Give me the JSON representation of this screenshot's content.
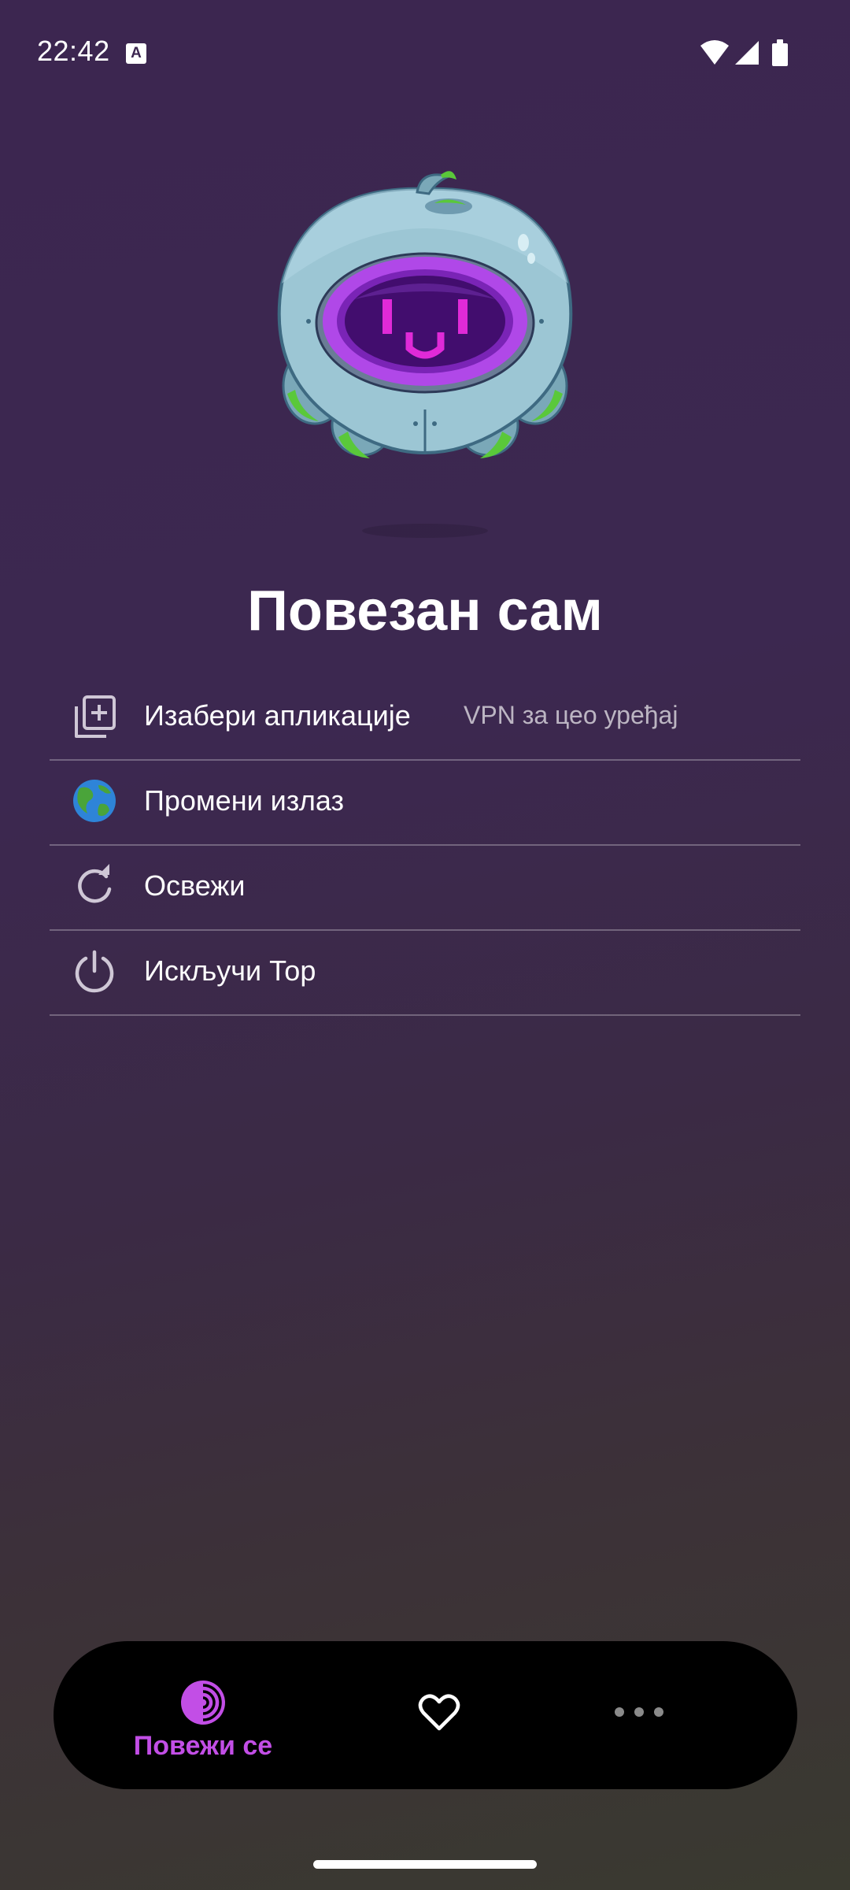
{
  "status_bar": {
    "time": "22:42",
    "notification_icon": "font-a-icon",
    "notification_glyph": "A",
    "icons": [
      "wifi-icon",
      "cell-signal-icon",
      "battery-icon"
    ]
  },
  "mascot": {
    "icon": "tor-onion-robot-mascot"
  },
  "status": {
    "title": "Повезан сам"
  },
  "menu": {
    "items": [
      {
        "label": "Изабери апликације",
        "value": "VPN за цео уређај",
        "icon": "library-add-icon"
      },
      {
        "label": "Промени излаз",
        "icon": "globe-icon"
      },
      {
        "label": "Освежи",
        "icon": "refresh-icon"
      },
      {
        "label": "Искључи Тор",
        "icon": "power-icon"
      }
    ]
  },
  "nav": {
    "connect_label": "Повежи се",
    "accent_color": "#c24ee6",
    "items": [
      "tor-connect-icon",
      "heart-icon",
      "more-icon"
    ]
  },
  "colors": {
    "background_top": "#3c2650",
    "background_bottom": "#3a3a30",
    "nav_background": "#000000",
    "accent": "#c24ee6"
  }
}
